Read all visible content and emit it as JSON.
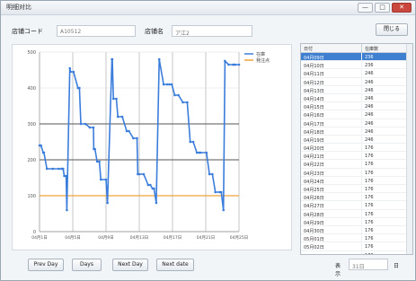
{
  "window": {
    "title": "明细对比",
    "controls": {
      "min": "—",
      "max": "□",
      "close": "✕"
    }
  },
  "toolbar": {
    "code_label": "店铺コード",
    "code_value": "A10512",
    "name_label": "店铺名",
    "name_value": "ア江2",
    "action_button": "閉じる"
  },
  "chart_data": {
    "type": "line",
    "legend": [
      "在庫",
      "発注点"
    ],
    "ylim": [
      0,
      500
    ],
    "yticks": [
      "0",
      "100",
      "200",
      "300",
      "400",
      "500"
    ],
    "xticks": [
      "04月1日",
      "04月5日",
      "04月9日",
      "04月13日",
      "04月17日",
      "04月21日",
      "04月25日"
    ],
    "series": [
      {
        "name": "在庫",
        "color": "#3b7ddb",
        "x": [
          0,
          0.2,
          0.5,
          0.6,
          1,
          1.8,
          2.6,
          3.0,
          3.1,
          3.2,
          3.35,
          3.6,
          3.7,
          4.1,
          4.2,
          4.6,
          5.2,
          5.4,
          5.6,
          6.2,
          6.8,
          7.3,
          7.35,
          7.5,
          7.8,
          8.1,
          8.3,
          9.0,
          9.2,
          9.8,
          9.85,
          10.0,
          10.4,
          10.6,
          11.2,
          11.8,
          12.1,
          12.7,
          13.2,
          13.3,
          13.5,
          14.1,
          14.7,
          15.0,
          15.3,
          15.5,
          15.8,
          16.2,
          16.8,
          17.3,
          17.6,
          17.9,
          18.3,
          18.8,
          19.4,
          20.0,
          20.4,
          20.8,
          21.3,
          21.6,
          21.8,
          22.6,
          23.0,
          23.4,
          23.8,
          24.4,
          24.6,
          24.9,
          25.1,
          25.6,
          26.2,
          26.3,
          26.5,
          27.0
        ],
        "y": [
          240,
          240,
          220,
          220,
          175,
          175,
          175,
          175,
          175,
          175,
          155,
          155,
          60,
          455,
          445,
          445,
          400,
          400,
          300,
          300,
          290,
          290,
          230,
          230,
          195,
          195,
          145,
          145,
          80,
          480,
          480,
          370,
          370,
          320,
          320,
          280,
          280,
          260,
          260,
          160,
          160,
          160,
          130,
          130,
          120,
          120,
          80,
          480,
          410,
          410,
          410,
          410,
          380,
          380,
          360,
          360,
          250,
          250,
          220,
          220,
          220,
          220,
          160,
          160,
          110,
          110,
          110,
          60,
          475,
          465,
          465,
          465,
          465,
          465
        ]
      },
      {
        "name": "発注点",
        "color": "#f0a43a",
        "y": 100
      }
    ],
    "hlines": [
      300,
      200
    ]
  },
  "list": {
    "headers": [
      "日付",
      "在庫数"
    ],
    "rows": [
      [
        "04月09日",
        "236"
      ],
      [
        "04月10日",
        "236"
      ],
      [
        "04月11日",
        "246"
      ],
      [
        "04月12日",
        "246"
      ],
      [
        "04月13日",
        "246"
      ],
      [
        "04月14日",
        "246"
      ],
      [
        "04月15日",
        "246"
      ],
      [
        "04月16日",
        "246"
      ],
      [
        "04月17日",
        "246"
      ],
      [
        "04月18日",
        "246"
      ],
      [
        "04月19日",
        "246"
      ],
      [
        "04月20日",
        "176"
      ],
      [
        "04月21日",
        "176"
      ],
      [
        "04月22日",
        "176"
      ],
      [
        "04月23日",
        "176"
      ],
      [
        "04月24日",
        "176"
      ],
      [
        "04月25日",
        "176"
      ],
      [
        "04月26日",
        "176"
      ],
      [
        "04月27日",
        "176"
      ],
      [
        "04月28日",
        "176"
      ],
      [
        "04月29日",
        "176"
      ],
      [
        "04月30日",
        "176"
      ],
      [
        "05月01日",
        "176"
      ],
      [
        "05月02日",
        "176"
      ],
      [
        "05月03日",
        "176"
      ]
    ]
  },
  "bottom": {
    "buttons": [
      "Prev Day",
      "Days",
      "Next Day",
      "Next date"
    ],
    "page_label": "表示",
    "page_value": "31日",
    "page_unit": "日"
  }
}
